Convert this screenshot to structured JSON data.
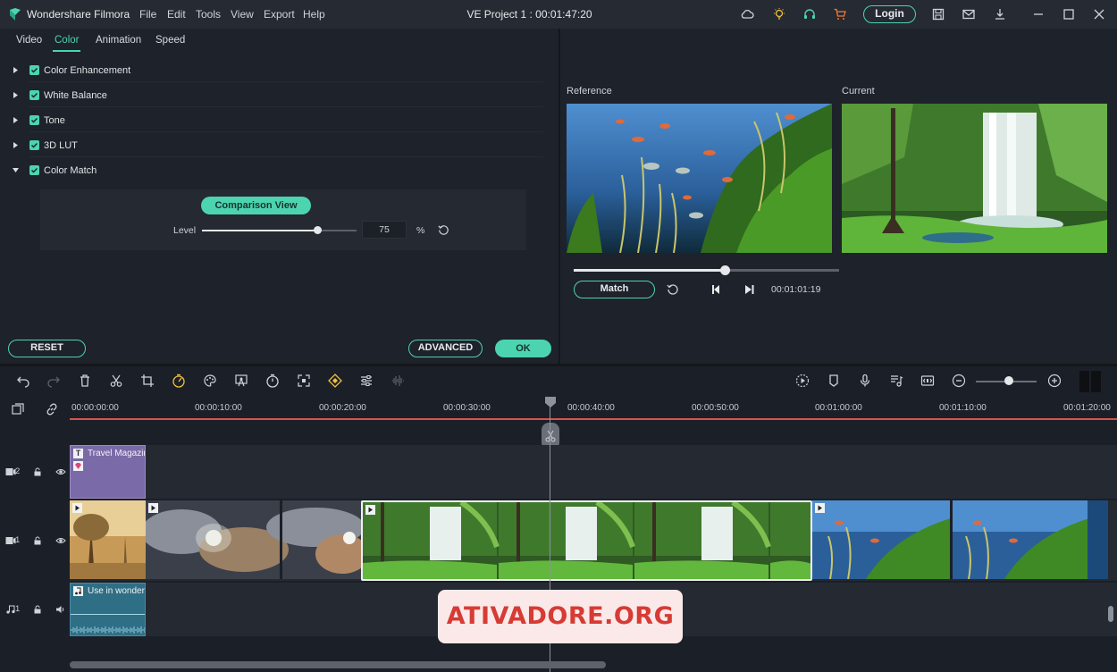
{
  "app": {
    "name": "Wondershare Filmora",
    "project_title": "VE Project 1 : 00:01:47:20",
    "menu": [
      "File",
      "Edit",
      "Tools",
      "View",
      "Export",
      "Help"
    ],
    "login_label": "Login",
    "title_icons": [
      "cloud-icon",
      "bulb-icon",
      "headset-icon",
      "cart-icon",
      "save-icon",
      "mail-icon",
      "download-icon",
      "minimize-icon",
      "maximize-icon",
      "close-icon"
    ]
  },
  "edit_panel": {
    "tabs": [
      "Video",
      "Color",
      "Animation",
      "Speed"
    ],
    "active_tab": "Color",
    "sections": [
      {
        "label": "Color Enhancement",
        "checked": true,
        "expanded": false
      },
      {
        "label": "White Balance",
        "checked": true,
        "expanded": false
      },
      {
        "label": "Tone",
        "checked": true,
        "expanded": false
      },
      {
        "label": "3D LUT",
        "checked": true,
        "expanded": false
      },
      {
        "label": "Color Match",
        "checked": true,
        "expanded": true
      }
    ],
    "color_match": {
      "comparison_button": "Comparison View",
      "level_label": "Level",
      "level_value": "75",
      "level_unit": "%",
      "level_fraction": 0.75
    },
    "reset_label": "RESET",
    "advanced_label": "ADVANCED",
    "ok_label": "OK"
  },
  "preview": {
    "reference_label": "Reference",
    "current_label": "Current",
    "progress_fraction": 0.57,
    "match_label": "Match",
    "timecode": "00:01:01:19"
  },
  "timeline": {
    "ruler_labels": [
      "00:00:00:00",
      "00:00:10:00",
      "00:00:20:00",
      "00:00:30:00",
      "00:00:40:00",
      "00:00:50:00",
      "00:01:00:00",
      "00:01:10:00",
      "00:01:20:00"
    ],
    "tracks": [
      {
        "id": "2",
        "clip_title": "Travel Magazin"
      },
      {
        "id": "1",
        "clip_title": ""
      },
      {
        "id": "1",
        "clip_title": "Use in wonderi"
      }
    ],
    "zoom_fraction": 0.55
  },
  "watermark": "ATIVADORE.ORG",
  "colors": {
    "accent": "#4cd4b0",
    "playhead_red": "#d9534f",
    "title_clip": "#7b6aa8",
    "audio_clip": "#2f6f86"
  }
}
